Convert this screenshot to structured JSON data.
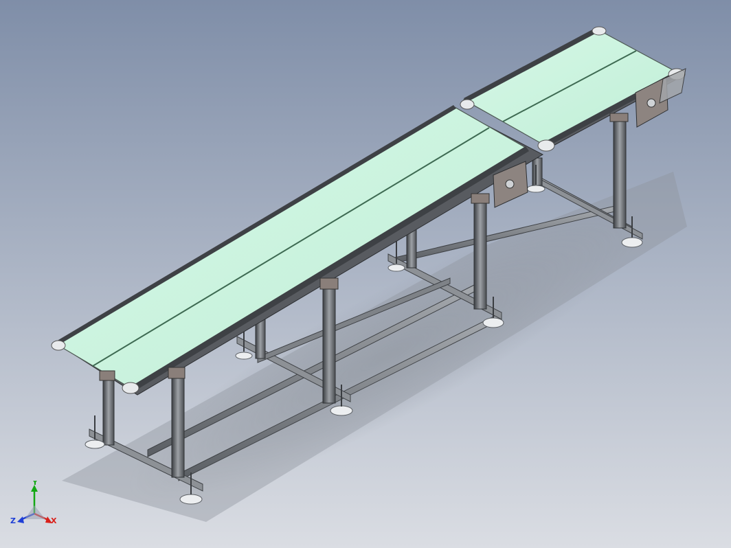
{
  "viewport": {
    "background_top": "#7f8ea8",
    "background_bottom": "#d9dde3",
    "belt_color": "#c9f2dc",
    "frame_color": "#4b4e53"
  },
  "triad": {
    "x_label": "X",
    "y_label": "Y",
    "z_label": "Z",
    "x_color": "#d9201a",
    "y_color": "#14a814",
    "z_color": "#1f3fd6"
  }
}
